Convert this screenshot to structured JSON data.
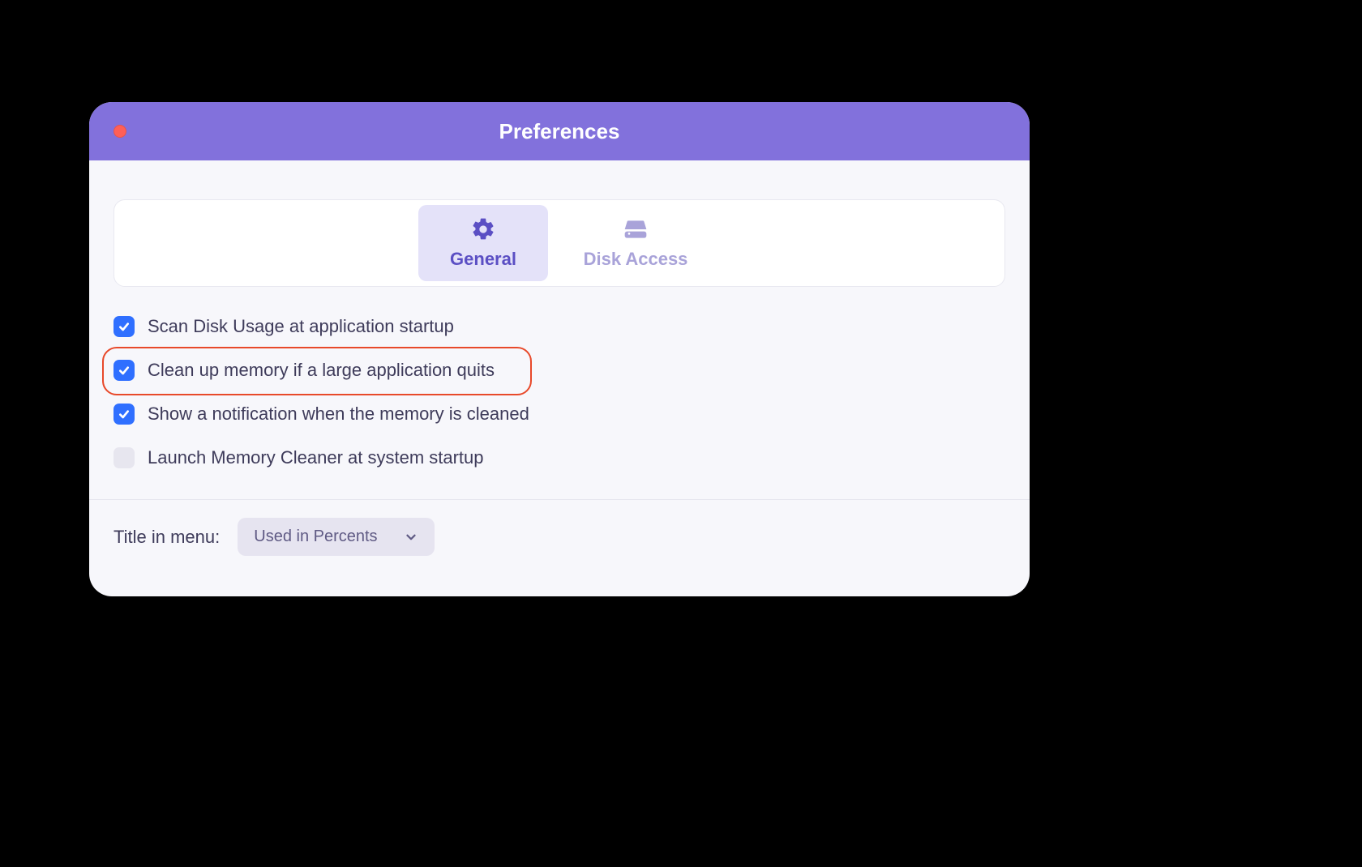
{
  "window": {
    "title": "Preferences"
  },
  "tabs": [
    {
      "label": "General",
      "active": true
    },
    {
      "label": "Disk Access",
      "active": false
    }
  ],
  "options": [
    {
      "label": "Scan Disk Usage at application startup",
      "checked": true,
      "highlighted": false
    },
    {
      "label": "Clean up memory if a large application quits",
      "checked": true,
      "highlighted": true
    },
    {
      "label": "Show a notification when the memory is cleaned",
      "checked": true,
      "highlighted": false
    },
    {
      "label": "Launch Memory Cleaner at system startup",
      "checked": false,
      "highlighted": false
    }
  ],
  "dropdown": {
    "label": "Title in menu:",
    "value": "Used in Percents"
  }
}
